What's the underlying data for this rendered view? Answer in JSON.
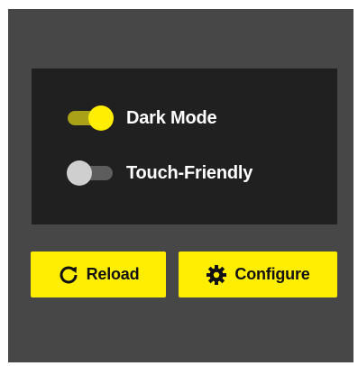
{
  "settings": {
    "dark_mode": {
      "label": "Dark Mode",
      "on": true,
      "icon": "toggle-on"
    },
    "touch_friendly": {
      "label": "Touch-Friendly",
      "on": false,
      "icon": "toggle-off"
    }
  },
  "actions": {
    "reload": {
      "label": "Reload",
      "icon": "refresh-icon"
    },
    "configure": {
      "label": "Configure",
      "icon": "gear-icon"
    }
  },
  "colors": {
    "background": "#474747",
    "panel": "#202020",
    "accent": "#ffee00",
    "toggle_track_on": "#a9a117",
    "toggle_track_off": "#5d5d5d",
    "toggle_thumb_off": "#cfcfcf",
    "text_light": "#ffffff",
    "text_dark": "#111111"
  }
}
